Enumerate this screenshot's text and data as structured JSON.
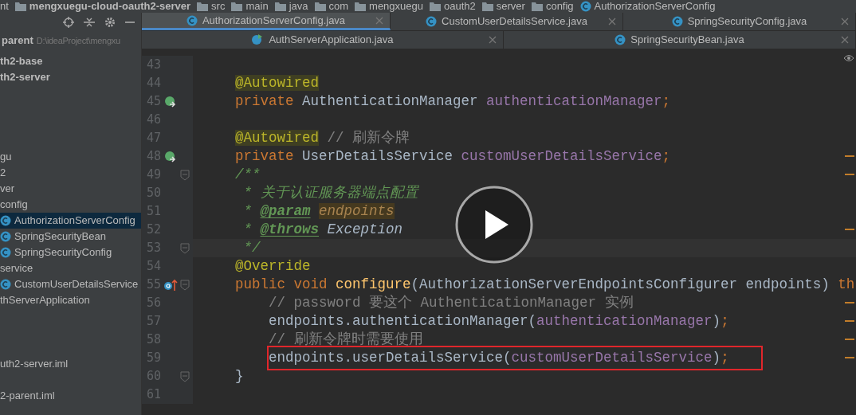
{
  "breadcrumbs": [
    "nt",
    "mengxuegu-cloud-oauth2-server",
    "src",
    "main",
    "java",
    "com",
    "mengxuegu",
    "oauth2",
    "server",
    "config",
    "AuthorizationServerConfig"
  ],
  "tab_rows": [
    [
      {
        "label": "AuthorizationServerConfig.java",
        "selected": true,
        "kind": "class"
      },
      {
        "label": "CustomUserDetailsService.java",
        "selected": false,
        "kind": "class"
      },
      {
        "label": "SpringSecurityConfig.java",
        "selected": false,
        "kind": "class"
      }
    ],
    [
      {
        "label": "AuthServerApplication.java",
        "selected": false,
        "kind": "app"
      },
      {
        "label": "SpringSecurityBean.java",
        "selected": false,
        "kind": "class"
      }
    ]
  ],
  "project": {
    "path_label": "parent",
    "path": "D:\\ideaProject\\mengxu",
    "rows": [
      {
        "kind": "module",
        "text": "th2-base",
        "selected": false
      },
      {
        "kind": "module",
        "text": "th2-server",
        "selected": false
      },
      {
        "kind": "blank"
      },
      {
        "kind": "blank"
      },
      {
        "kind": "blank"
      },
      {
        "kind": "blank"
      },
      {
        "kind": "folder",
        "text": "gu",
        "selected": false
      },
      {
        "kind": "folder",
        "text": "2",
        "selected": false
      },
      {
        "kind": "folder",
        "text": "ver",
        "selected": false
      },
      {
        "kind": "folder",
        "text": "config",
        "selected": false
      },
      {
        "kind": "class",
        "text": "AuthorizationServerConfig",
        "selected": true
      },
      {
        "kind": "class",
        "text": "SpringSecurityBean",
        "selected": false
      },
      {
        "kind": "class",
        "text": "SpringSecurityConfig",
        "selected": false
      },
      {
        "kind": "folder",
        "text": "service",
        "selected": false
      },
      {
        "kind": "class",
        "text": "CustomUserDetailsService",
        "selected": false
      },
      {
        "kind": "folder",
        "text": "thServerApplication",
        "selected": false
      },
      {
        "kind": "blank"
      },
      {
        "kind": "blank"
      },
      {
        "kind": "blank"
      },
      {
        "kind": "file",
        "text": "uth2-server.iml",
        "selected": false
      },
      {
        "kind": "blank"
      },
      {
        "kind": "file",
        "text": "2-parent.iml",
        "selected": false
      }
    ]
  },
  "editor": {
    "lines": [
      {
        "number": "43",
        "kind": "member"
      },
      {
        "number": "44",
        "kind": "member",
        "segments": [
          {
            "kind": "ann",
            "text": "@Autowired"
          }
        ]
      },
      {
        "number": "45",
        "kind": "member",
        "implements": true,
        "segments": [
          {
            "kind": "kw",
            "text": "private "
          },
          {
            "kind": "plain",
            "text": "AuthenticationManager "
          },
          {
            "kind": "field",
            "text": "authenticationManager"
          },
          {
            "kind": "kw",
            "text": ";"
          }
        ]
      },
      {
        "number": "46",
        "kind": "member"
      },
      {
        "number": "47",
        "kind": "member",
        "segments": [
          {
            "kind": "ann",
            "text": "@Autowired"
          },
          {
            "kind": "comment",
            "text": " // 刷新令牌"
          }
        ]
      },
      {
        "number": "48",
        "kind": "member",
        "implements": true,
        "marker": true,
        "segments": [
          {
            "kind": "kw",
            "text": "private "
          },
          {
            "kind": "plain",
            "text": "UserDetailsService "
          },
          {
            "kind": "field",
            "text": "customUserDetailsService"
          },
          {
            "kind": "kw",
            "text": ";"
          }
        ]
      },
      {
        "number": "49",
        "kind": "member",
        "fold": true,
        "marker": true,
        "segments": [
          {
            "kind": "doc",
            "text": "/**"
          }
        ]
      },
      {
        "number": "50",
        "kind": "doc",
        "segments": [
          {
            "kind": "doc",
            "text": "* 关于认证服务器端点配置"
          }
        ]
      },
      {
        "number": "51",
        "kind": "doc",
        "segments": [
          {
            "kind": "doc",
            "text": "* "
          },
          {
            "kind": "doctag",
            "text": "@param"
          },
          {
            "kind": "docparam",
            "text": "endpoints"
          }
        ]
      },
      {
        "number": "52",
        "kind": "doc",
        "marker": true,
        "segments": [
          {
            "kind": "doc",
            "text": "* "
          },
          {
            "kind": "doctag",
            "text": "@throws"
          },
          {
            "kind": "docref",
            "text": "Exception"
          }
        ]
      },
      {
        "number": "53",
        "kind": "doc",
        "fold": true,
        "current": true,
        "segments": [
          {
            "kind": "doc",
            "text": "*/"
          }
        ]
      },
      {
        "number": "54",
        "kind": "member",
        "segments": [
          {
            "kind": "ann2",
            "text": "@Override"
          }
        ]
      },
      {
        "number": "55",
        "kind": "member",
        "overrides": true,
        "fold": true,
        "segments": [
          {
            "kind": "kw",
            "text": "public void "
          },
          {
            "kind": "method",
            "text": "configure"
          },
          {
            "kind": "plain",
            "text": "(AuthorizationServerEndpointsConfigurer endpoints) "
          },
          {
            "kind": "kw",
            "text": "th"
          }
        ]
      },
      {
        "number": "56",
        "kind": "body",
        "marker": true,
        "segments": [
          {
            "kind": "comment",
            "text": "// password 要这个 AuthenticationManager 实例"
          }
        ]
      },
      {
        "number": "57",
        "kind": "body",
        "marker": true,
        "segments": [
          {
            "kind": "plain",
            "text": "endpoints.authenticationManager("
          },
          {
            "kind": "field",
            "text": "authenticationManager"
          },
          {
            "kind": "plain",
            "text": ")"
          },
          {
            "kind": "kw",
            "text": ";"
          }
        ]
      },
      {
        "number": "58",
        "kind": "body",
        "marker": true,
        "segments": [
          {
            "kind": "comment",
            "text": "// 刷新令牌时需要使用"
          }
        ]
      },
      {
        "number": "59",
        "kind": "body",
        "boxed": true,
        "marker": true,
        "segments": [
          {
            "kind": "plain",
            "text": "endpoints.userDetailsService("
          },
          {
            "kind": "field",
            "text": "customUserDetailsService"
          },
          {
            "kind": "plain",
            "text": ")"
          },
          {
            "kind": "kw",
            "text": ";"
          }
        ]
      },
      {
        "number": "60",
        "kind": "member",
        "fold": true,
        "segments": [
          {
            "kind": "plain",
            "text": "}"
          }
        ]
      },
      {
        "number": "61",
        "kind": "member"
      }
    ]
  },
  "video": {
    "paused": true
  }
}
